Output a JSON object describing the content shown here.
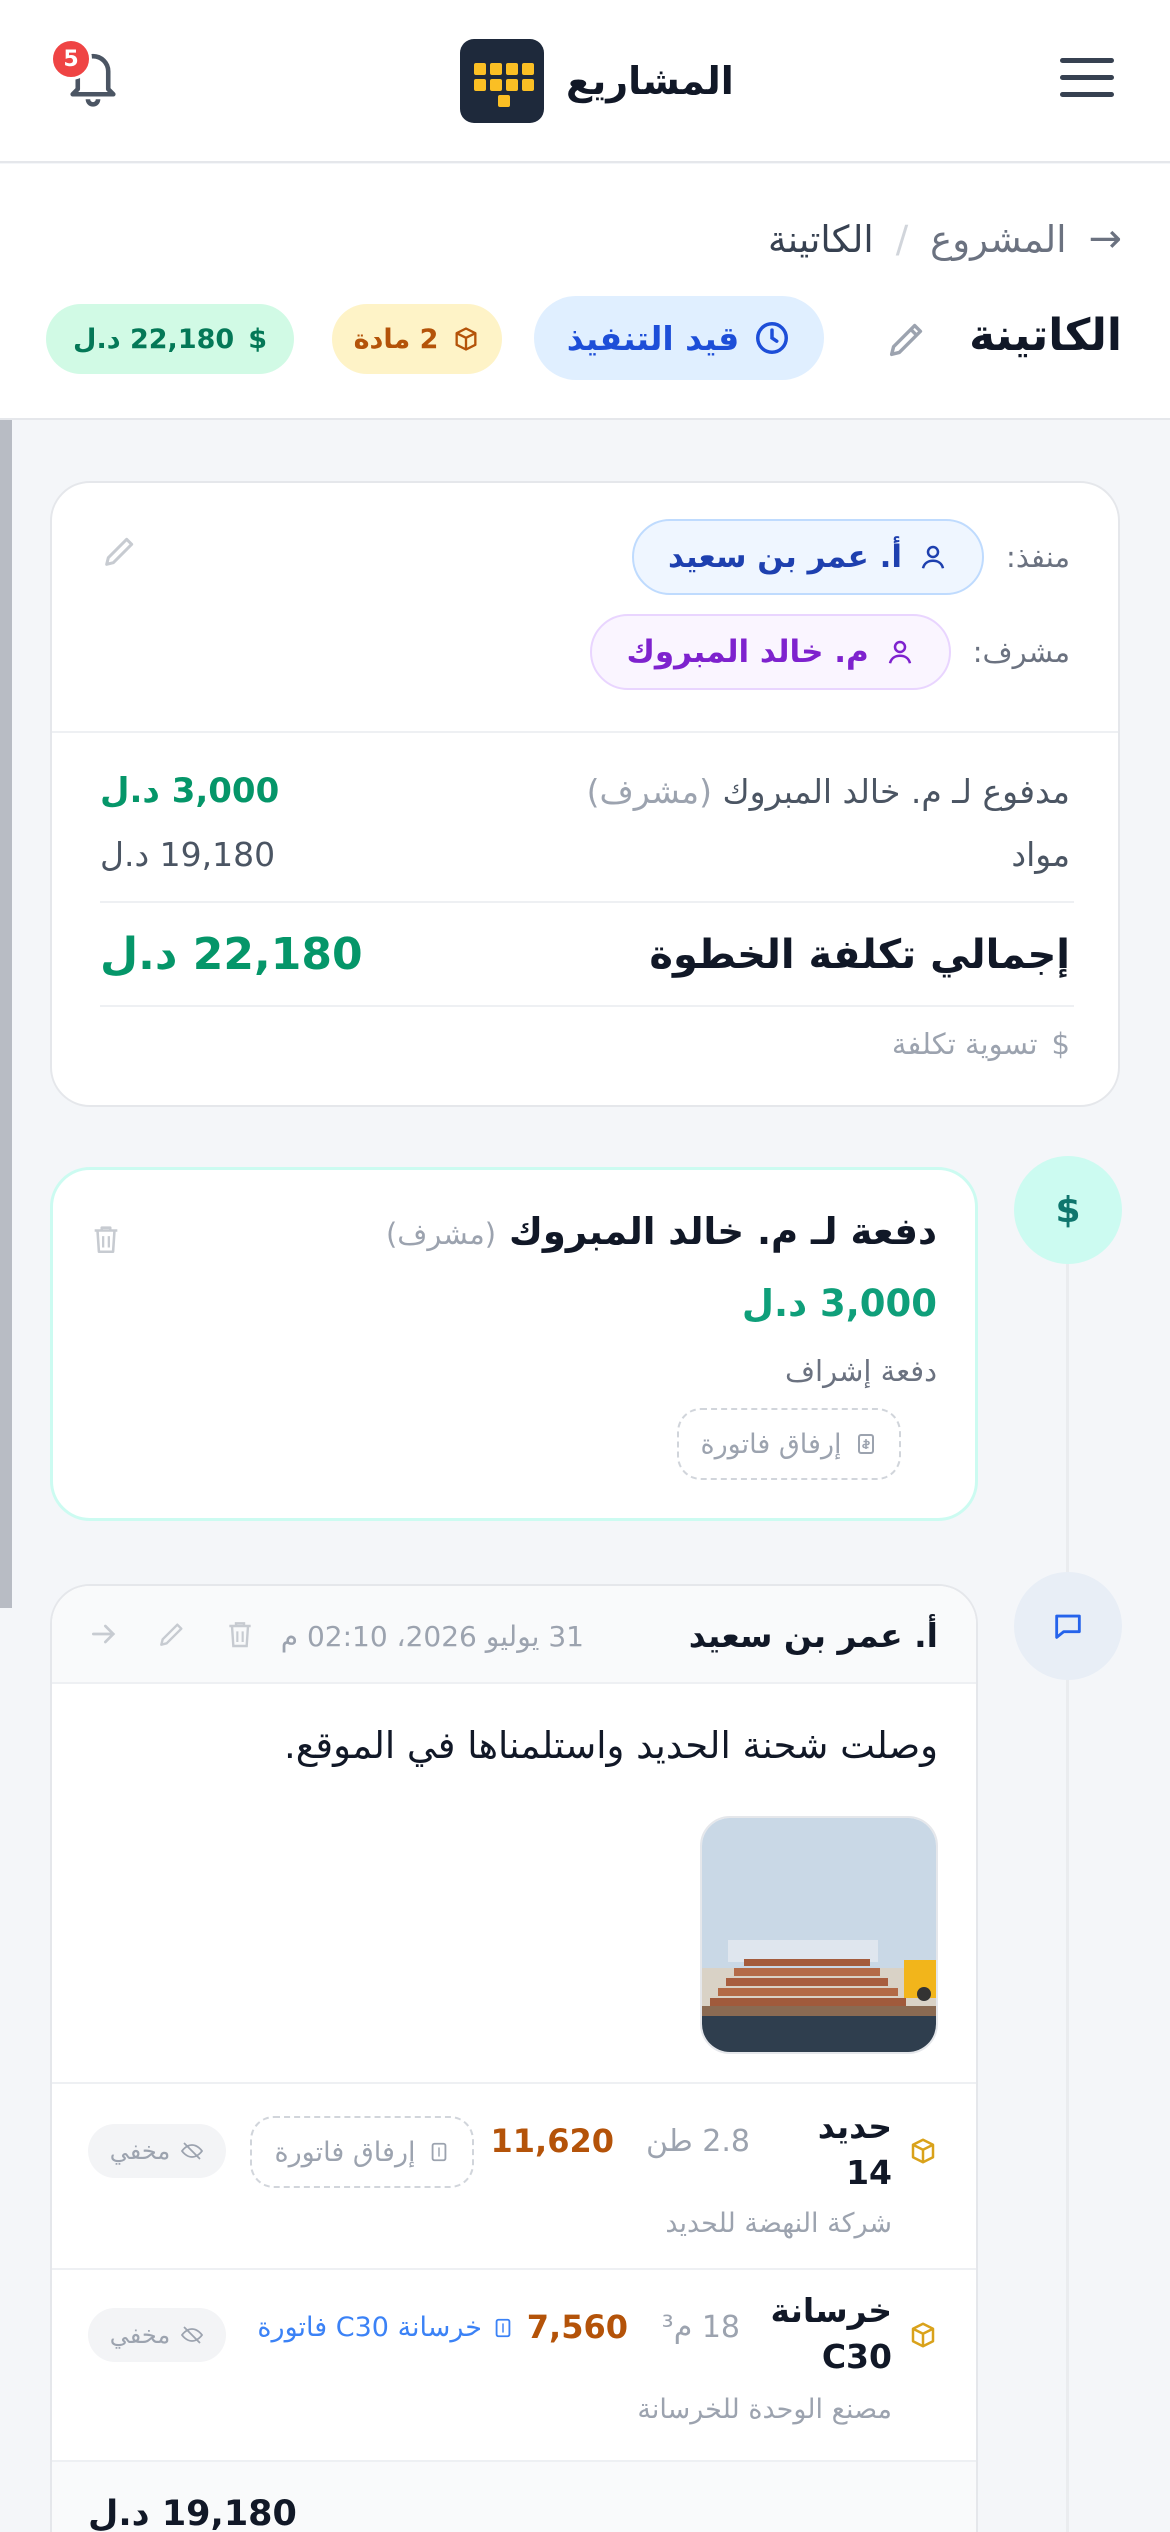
{
  "topbar": {
    "title": "المشاريع",
    "notification_count": "5",
    "icons": {
      "menu": "menu-icon",
      "logo": "grid-logo-icon",
      "bell": "bell-icon"
    }
  },
  "breadcrumb": {
    "parent": "المشروع",
    "separator": "/",
    "current": "الكاتينة"
  },
  "page": {
    "title": "الكاتينة",
    "status": "قيد التنفيذ",
    "materials_badge": "2 مادة",
    "total_badge": "22,180 د.ل"
  },
  "summary": {
    "executor_label": "منفذ:",
    "executor_name": "أ. عمر بن سعيد",
    "supervisor_label": "مشرف:",
    "supervisor_name": "م. خالد المبروك",
    "paid_label": "مدفوع لـ م. خالد المبروك",
    "paid_role": "(مشرف)",
    "paid_amount": "3,000 د.ل",
    "materials_label": "مواد",
    "materials_amount": "19,180 د.ل",
    "total_label": "إجمالي تكلفة الخطوة",
    "total_amount": "22,180 د.ل",
    "settle_label": "تسوية تكلفة"
  },
  "payment": {
    "title": "دفعة لـ م. خالد المبروك",
    "role": "(مشرف)",
    "amount": "3,000 د.ل",
    "note": "دفعة إشراف",
    "attach_label": "إرفاق فاتورة"
  },
  "post": {
    "author": "أ. عمر بن سعيد",
    "date": "31 يوليو 2026، 02:10 م",
    "text": "وصلت شحنة الحديد واستلمناها في الموقع.",
    "materials": [
      {
        "name_line1": "حديد",
        "name_line2": "14",
        "quantity": "2.8 طن",
        "amount": "11,620",
        "supplier": "شركة النهضة للحديد",
        "attach_label": "إرفاق فاتورة",
        "visibility": "مخفي"
      },
      {
        "name_line1": "خرسانة",
        "name_line2": "C30",
        "quantity": "18 م³",
        "amount": "7,560",
        "supplier": "مصنع الوحدة للخرسانة",
        "invoice_label": "خرسانة C30 فاتورة",
        "visibility": "مخفي"
      }
    ],
    "footer_total": "19,180 د.ل"
  },
  "colors": {
    "accent_blue": "#1d4ed8",
    "success_green": "#059669",
    "amber": "#b45309",
    "purple": "#7e22ce",
    "danger": "#ef4444"
  }
}
